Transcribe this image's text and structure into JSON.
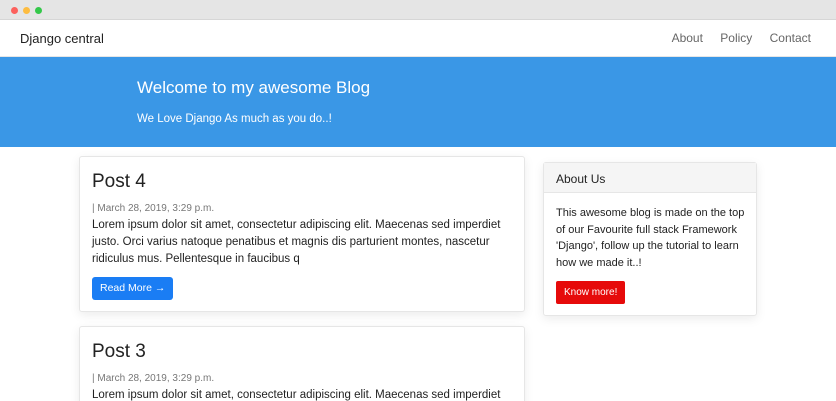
{
  "navbar": {
    "brand": "Django central",
    "links": [
      "About",
      "Policy",
      "Contact"
    ]
  },
  "hero": {
    "title": "Welcome to my awesome Blog",
    "subtitle": "We Love Django As much as you do..!"
  },
  "posts": [
    {
      "title": "Post 4",
      "meta": "| March 28, 2019, 3:29 p.m.",
      "body": "Lorem ipsum dolor sit amet, consectetur adipiscing elit. Maecenas sed imperdiet justo. Orci varius natoque penatibus et magnis dis parturient montes, nascetur ridiculus mus. Pellentesque in faucibus q",
      "button": "Read More →"
    },
    {
      "title": "Post 3",
      "meta": "| March 28, 2019, 3:29 p.m.",
      "body": "Lorem ipsum dolor sit amet, consectetur adipiscing elit. Maecenas sed imperdiet"
    }
  ],
  "sidebar": {
    "heading": "About Us",
    "text": "This awesome blog is made on the top of our Favourite full stack Framework 'Django', follow up the tutorial to learn how we made it..!",
    "button": "Know more!"
  },
  "colors": {
    "hero_bg": "#3a97e6",
    "read_more_bg": "#1a7df4",
    "know_more_bg": "#e60a0a"
  }
}
